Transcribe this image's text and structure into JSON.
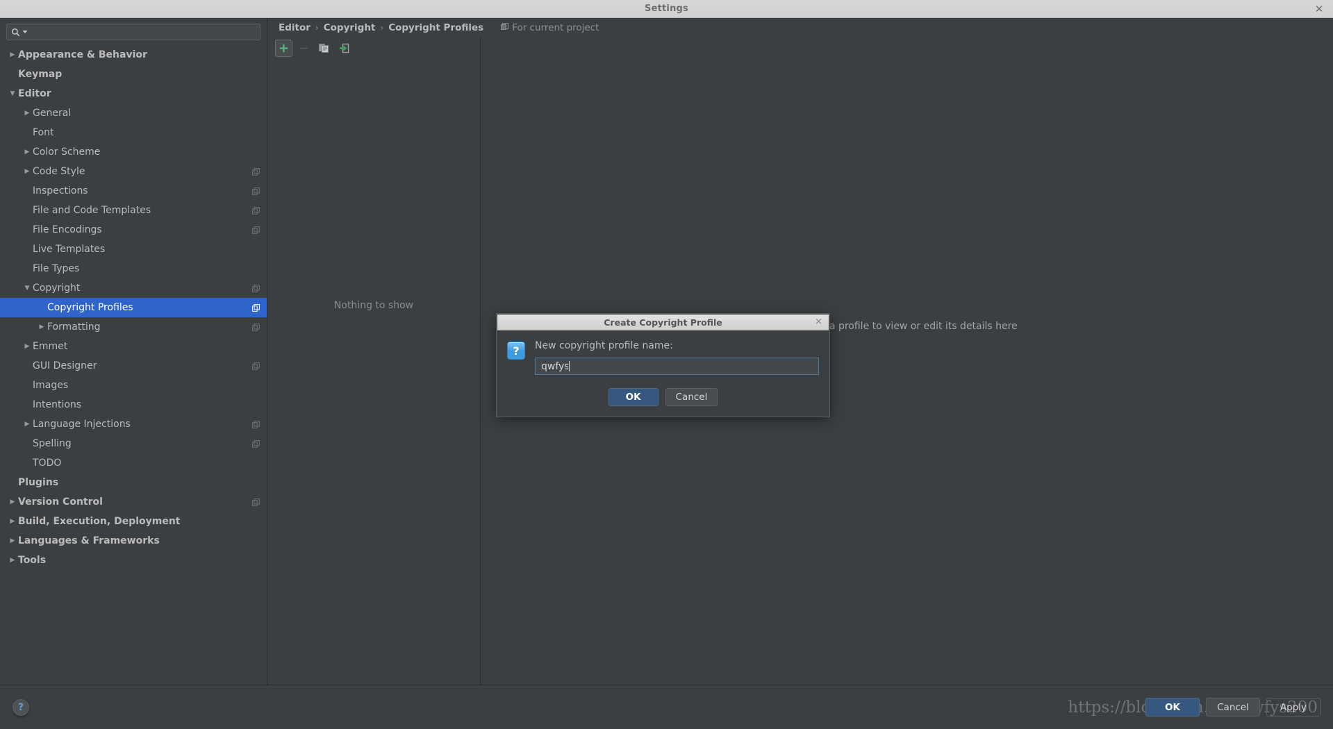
{
  "window": {
    "title": "Settings",
    "close_icon": "close-icon"
  },
  "search": {
    "value": "",
    "placeholder": "",
    "icon": "search-icon"
  },
  "sidebar": {
    "items": [
      {
        "label": "Appearance & Behavior",
        "depth": 0,
        "twist": "collapsed",
        "bold": true,
        "copy": false,
        "selected": false
      },
      {
        "label": "Keymap",
        "depth": 0,
        "twist": "none",
        "bold": true,
        "copy": false,
        "selected": false
      },
      {
        "label": "Editor",
        "depth": 0,
        "twist": "expanded",
        "bold": true,
        "copy": false,
        "selected": false
      },
      {
        "label": "General",
        "depth": 1,
        "twist": "collapsed",
        "bold": false,
        "copy": false,
        "selected": false
      },
      {
        "label": "Font",
        "depth": 1,
        "twist": "none",
        "bold": false,
        "copy": false,
        "selected": false
      },
      {
        "label": "Color Scheme",
        "depth": 1,
        "twist": "collapsed",
        "bold": false,
        "copy": false,
        "selected": false
      },
      {
        "label": "Code Style",
        "depth": 1,
        "twist": "collapsed",
        "bold": false,
        "copy": true,
        "selected": false
      },
      {
        "label": "Inspections",
        "depth": 1,
        "twist": "none",
        "bold": false,
        "copy": true,
        "selected": false
      },
      {
        "label": "File and Code Templates",
        "depth": 1,
        "twist": "none",
        "bold": false,
        "copy": true,
        "selected": false
      },
      {
        "label": "File Encodings",
        "depth": 1,
        "twist": "none",
        "bold": false,
        "copy": true,
        "selected": false
      },
      {
        "label": "Live Templates",
        "depth": 1,
        "twist": "none",
        "bold": false,
        "copy": false,
        "selected": false
      },
      {
        "label": "File Types",
        "depth": 1,
        "twist": "none",
        "bold": false,
        "copy": false,
        "selected": false
      },
      {
        "label": "Copyright",
        "depth": 1,
        "twist": "expanded",
        "bold": false,
        "copy": true,
        "selected": false
      },
      {
        "label": "Copyright Profiles",
        "depth": 2,
        "twist": "none",
        "bold": false,
        "copy": true,
        "selected": true
      },
      {
        "label": "Formatting",
        "depth": 2,
        "twist": "collapsed",
        "bold": false,
        "copy": true,
        "selected": false
      },
      {
        "label": "Emmet",
        "depth": 1,
        "twist": "collapsed",
        "bold": false,
        "copy": false,
        "selected": false
      },
      {
        "label": "GUI Designer",
        "depth": 1,
        "twist": "none",
        "bold": false,
        "copy": true,
        "selected": false
      },
      {
        "label": "Images",
        "depth": 1,
        "twist": "none",
        "bold": false,
        "copy": false,
        "selected": false
      },
      {
        "label": "Intentions",
        "depth": 1,
        "twist": "none",
        "bold": false,
        "copy": false,
        "selected": false
      },
      {
        "label": "Language Injections",
        "depth": 1,
        "twist": "collapsed",
        "bold": false,
        "copy": true,
        "selected": false
      },
      {
        "label": "Spelling",
        "depth": 1,
        "twist": "none",
        "bold": false,
        "copy": true,
        "selected": false
      },
      {
        "label": "TODO",
        "depth": 1,
        "twist": "none",
        "bold": false,
        "copy": false,
        "selected": false
      },
      {
        "label": "Plugins",
        "depth": 0,
        "twist": "none",
        "bold": true,
        "copy": false,
        "selected": false
      },
      {
        "label": "Version Control",
        "depth": 0,
        "twist": "collapsed",
        "bold": true,
        "copy": true,
        "selected": false
      },
      {
        "label": "Build, Execution, Deployment",
        "depth": 0,
        "twist": "collapsed",
        "bold": true,
        "copy": false,
        "selected": false
      },
      {
        "label": "Languages & Frameworks",
        "depth": 0,
        "twist": "collapsed",
        "bold": true,
        "copy": false,
        "selected": false
      },
      {
        "label": "Tools",
        "depth": 0,
        "twist": "collapsed",
        "bold": true,
        "copy": false,
        "selected": false
      }
    ]
  },
  "breadcrumb": {
    "crumbs": [
      "Editor",
      "Copyright",
      "Copyright Profiles"
    ],
    "separator": "›",
    "scope_label": "For current project",
    "scope_icon": "project-scope-icon"
  },
  "profiles_panel": {
    "toolbar": [
      {
        "name": "add-profile-button",
        "icon": "plus-icon",
        "state": "active"
      },
      {
        "name": "remove-profile-button",
        "icon": "minus-icon",
        "state": "disabled"
      },
      {
        "name": "copy-profile-button",
        "icon": "copy-icon",
        "state": "normal"
      },
      {
        "name": "import-profile-button",
        "icon": "import-icon",
        "state": "normal"
      }
    ],
    "empty_text": "Nothing to show",
    "detail_text": "Select a profile to view or edit its details here"
  },
  "bottom_bar": {
    "help_icon": "help-icon",
    "help_label": "?",
    "buttons": [
      {
        "label": "OK",
        "style": "primary"
      },
      {
        "label": "Cancel",
        "style": "normal"
      },
      {
        "label": "Apply",
        "style": "ghost"
      }
    ],
    "watermark": "https://blog.csdn.net/qwfys200"
  },
  "dialog": {
    "title": "Create Copyright Profile",
    "close_icon": "close-icon",
    "question_icon": "question-icon",
    "question_glyph": "?",
    "field_label": "New copyright profile name:",
    "field_value": "qwfys",
    "field_placeholder": "",
    "ok_label": "OK",
    "cancel_label": "Cancel"
  },
  "colors": {
    "background": "#3c3f41",
    "selection_blue": "#2f65ca",
    "primary_button": "#365880",
    "accent_green": "#4caf6e",
    "titlebar": "#d4d4d2"
  }
}
